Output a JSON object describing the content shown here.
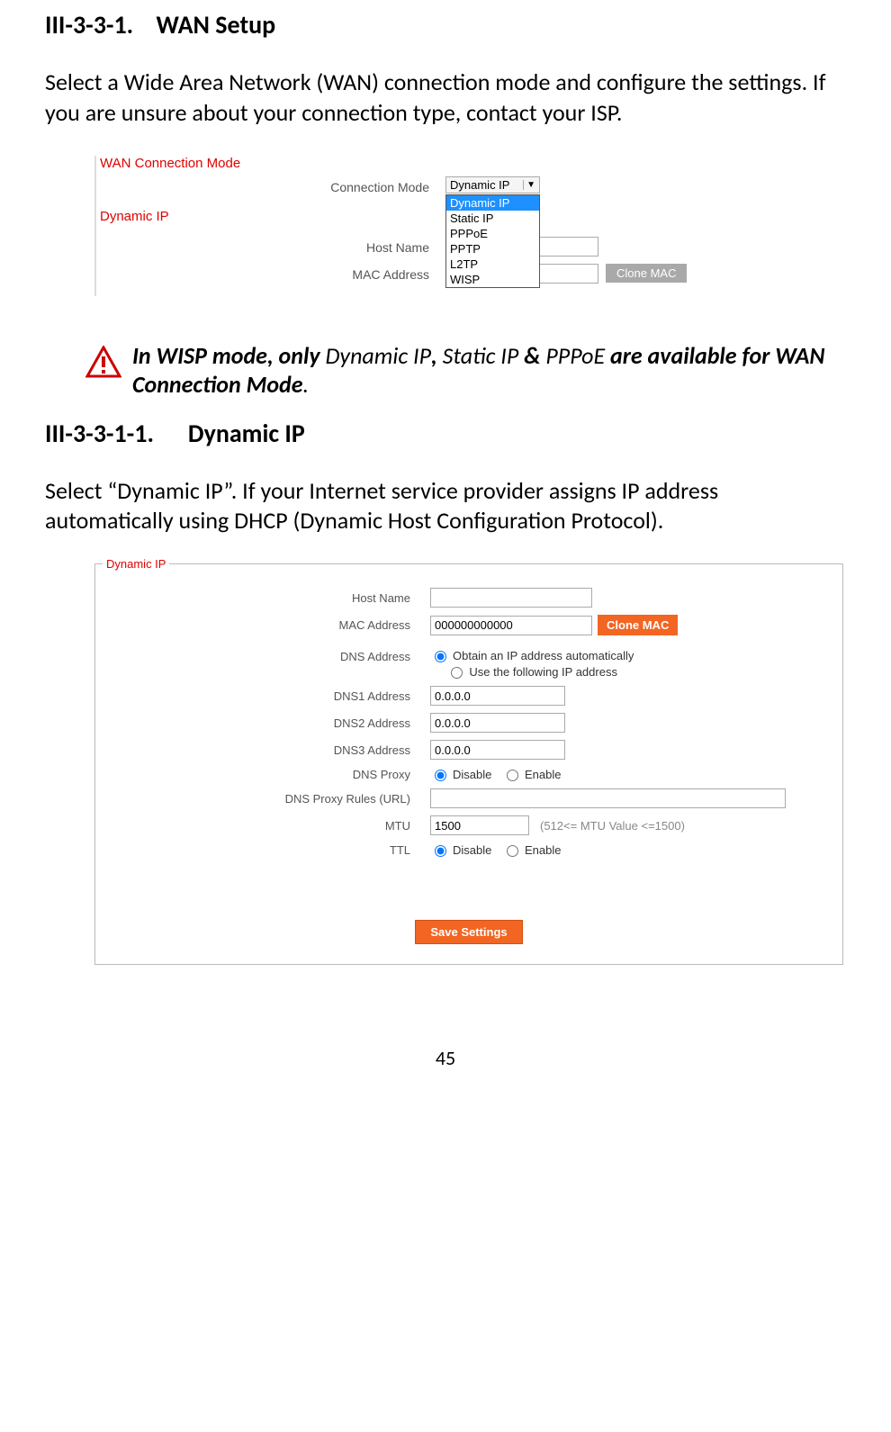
{
  "section": {
    "number": "III-3-3-1.",
    "title": "WAN Setup",
    "intro": "Select a Wide Area Network (WAN) connection mode and configure the settings. If you are unsure about your connection type, contact your ISP."
  },
  "shot1": {
    "legend_wan": "WAN  Connection Mode",
    "label_conn_mode": "Connection Mode",
    "selected_value": "Dynamic IP",
    "options": [
      "Dynamic IP",
      "Static IP",
      "PPPoE",
      "PPTP",
      "L2TP",
      "WISP"
    ],
    "legend_dynip": "Dynamic IP",
    "label_host": "Host Name",
    "label_mac": "MAC Address",
    "btn_clone": "Clone MAC"
  },
  "note": {
    "pre": "In WISP mode, only ",
    "mid1": "Dynamic IP",
    "mid2": ", ",
    "mid3": "Static IP",
    "mid4": " & ",
    "mid5": "PPPoE",
    "post": " are available for WAN Connection Mode",
    "dot": "."
  },
  "subsection": {
    "number": "III-3-3-1-1.",
    "title": "Dynamic IP",
    "intro": "Select “Dynamic IP”. If your Internet service provider assigns IP address automatically using DHCP (Dynamic Host Configuration Protocol)."
  },
  "shot2": {
    "legend": "Dynamic IP",
    "host_label": "Host Name",
    "host_value": "",
    "mac_label": "MAC Address",
    "mac_value": "000000000000",
    "clone_btn": "Clone MAC",
    "dns_addr_label": "DNS  Address",
    "dns_opt_auto": "Obtain an IP address automatically",
    "dns_opt_manual": "Use the following IP address",
    "dns1_label": "DNS1  Address",
    "dns1_value": "0.0.0.0",
    "dns2_label": "DNS2  Address",
    "dns2_value": "0.0.0.0",
    "dns3_label": "DNS3  Address",
    "dns3_value": "0.0.0.0",
    "dnsproxy_label": "DNS Proxy",
    "disable": "Disable",
    "enable": "Enable",
    "dnsrules_label": "DNS Proxy Rules (URL)",
    "dnsrules_value": "",
    "mtu_label": "MTU",
    "mtu_value": "1500",
    "mtu_hint": "(512<= MTU  Value <=1500)",
    "ttl_label": "TTL",
    "save_btn": "Save Settings"
  },
  "page_number": "45"
}
